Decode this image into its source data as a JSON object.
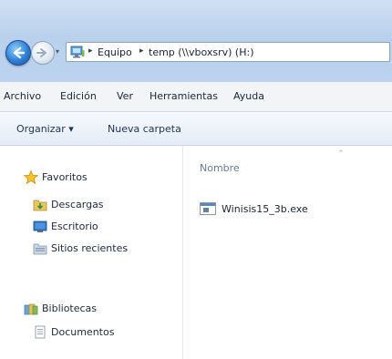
{
  "address_bar": {
    "crumbs": [
      "Equipo",
      "temp (\\\\vboxsrv) (H:)"
    ],
    "separator": "▸",
    "history_dropdown": "▾"
  },
  "menu": {
    "items": [
      "Archivo",
      "Edición",
      "Ver",
      "Herramientas",
      "Ayuda"
    ]
  },
  "toolbar": {
    "organize_label": "Organizar ▾",
    "new_folder_label": "Nueva carpeta"
  },
  "nav_pane": {
    "favorites_label": "Favoritos",
    "favorites": [
      "Descargas",
      "Escritorio",
      "Sitios recientes"
    ],
    "libraries_label": "Bibliotecas",
    "libraries": [
      "Documentos"
    ]
  },
  "content": {
    "column_name": "Nombre",
    "sort_indicator": "^",
    "files": [
      {
        "name": "Winisis15_3b.exe",
        "icon": "exe-file-icon"
      }
    ]
  },
  "icons": {
    "back": "back-arrow-icon",
    "forward": "forward-arrow-icon",
    "computer": "computer-icon",
    "star": "star-icon",
    "downloads": "downloads-folder-icon",
    "desktop": "desktop-icon",
    "recent": "recent-places-icon",
    "libraries": "libraries-icon",
    "documents": "documents-icon"
  },
  "colors": {
    "chrome_blue": "#b9d1ec",
    "nav_button_blue": "#2f7fd6"
  }
}
